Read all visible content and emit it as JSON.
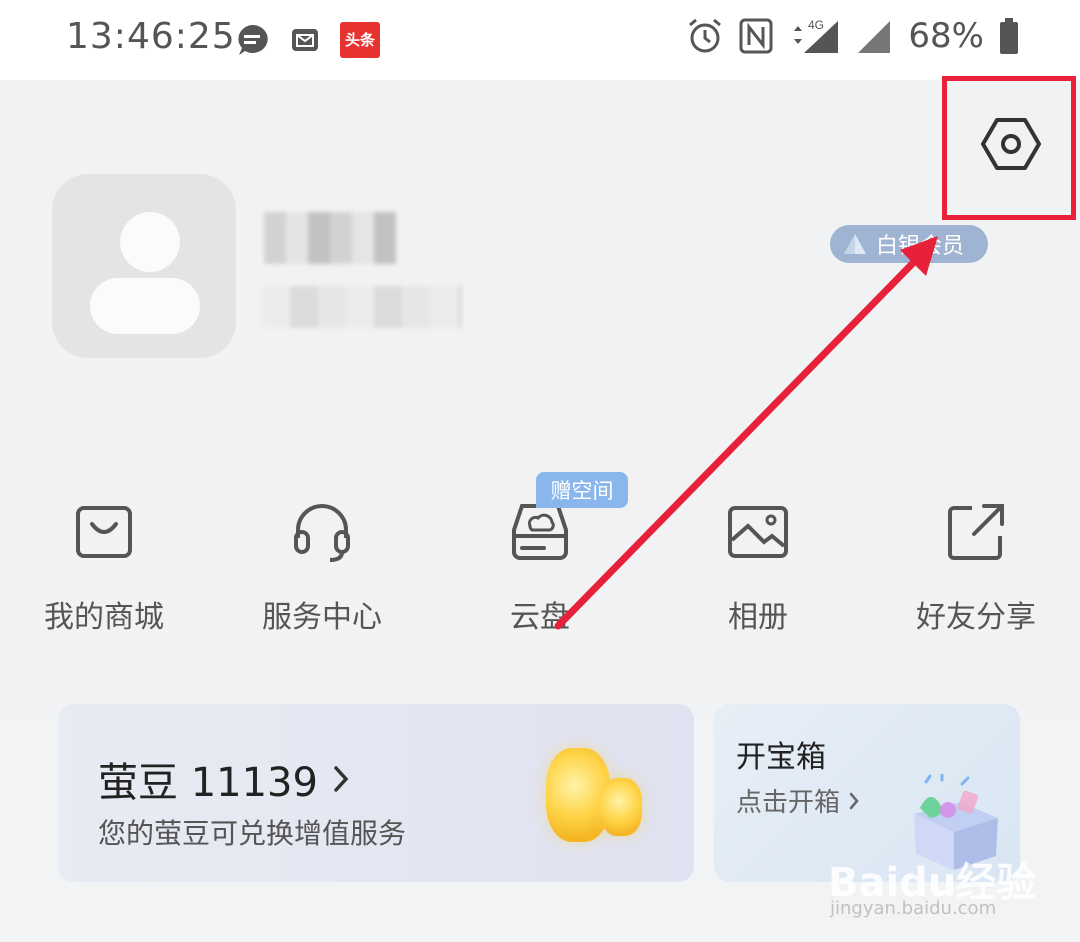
{
  "status_bar": {
    "time": "13:46:25",
    "headline_badge": "头条",
    "network": "4G",
    "battery": "68%"
  },
  "profile": {
    "member_badge": "白银会员"
  },
  "quick_actions": [
    {
      "label": "我的商城",
      "icon": "shopping-bag-icon"
    },
    {
      "label": "服务中心",
      "icon": "headset-icon"
    },
    {
      "label": "云盘",
      "icon": "cloud-drive-icon"
    },
    {
      "label": "相册",
      "icon": "photo-album-icon"
    },
    {
      "label": "好友分享",
      "icon": "share-icon"
    }
  ],
  "cloud_promo": "赠空间",
  "beans_card": {
    "title": "萤豆 11139",
    "subtitle": "您的萤豆可兑换增值服务"
  },
  "chest_card": {
    "title": "开宝箱",
    "subtitle": "点击开箱"
  },
  "watermark": {
    "text": "Baidu经验",
    "url": "jingyan.baidu.com"
  },
  "colors": {
    "highlight": "#e8213a",
    "member_badge": "#9fb4d2",
    "promo_tag": "#8ab6ee"
  }
}
